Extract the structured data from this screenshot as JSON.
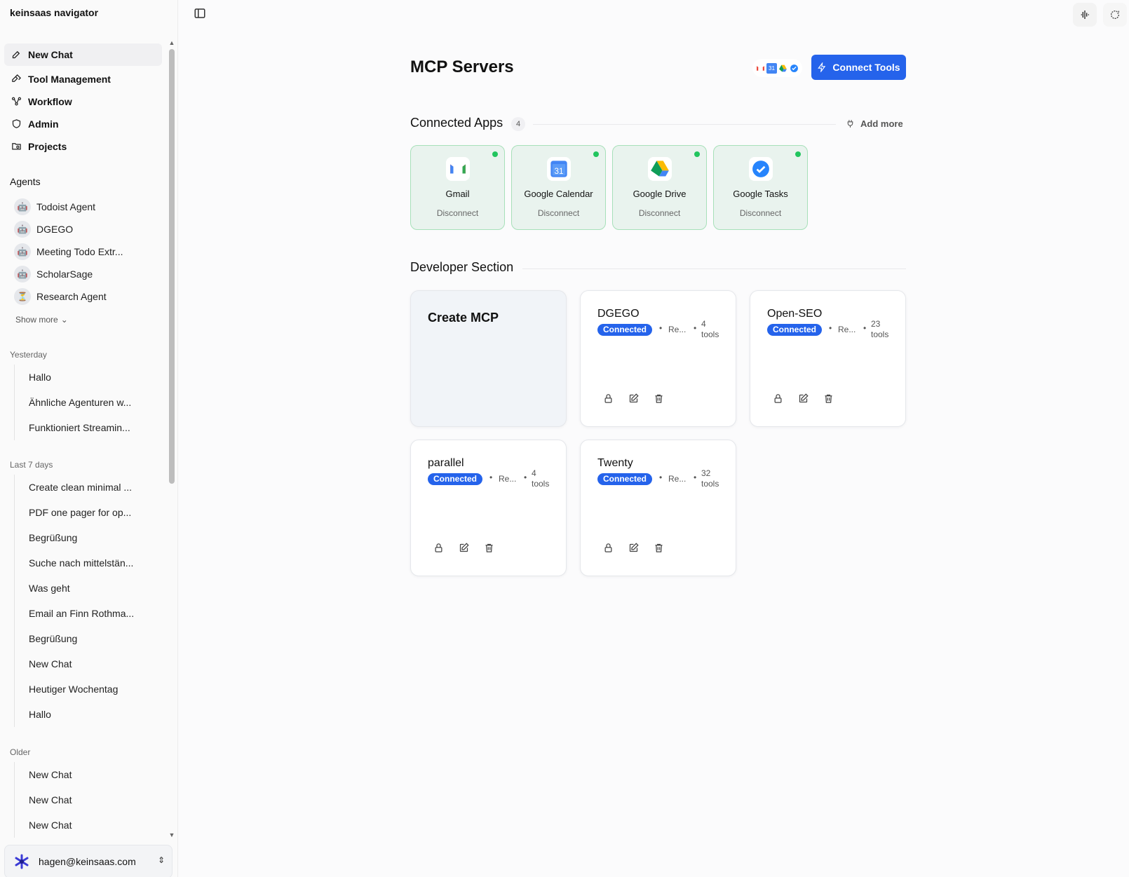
{
  "app": {
    "brand": "keinsaas navigator"
  },
  "nav": [
    {
      "label": "New Chat",
      "icon": "edit-icon"
    },
    {
      "label": "Tool Management",
      "icon": "tools-icon"
    },
    {
      "label": "Workflow",
      "icon": "workflow-icon"
    },
    {
      "label": "Admin",
      "icon": "shield-icon"
    },
    {
      "label": "Projects",
      "icon": "folder-icon"
    }
  ],
  "agents": {
    "label": "Agents",
    "items": [
      "Todoist Agent",
      "DGEGO",
      "Meeting Todo Extr...",
      "ScholarSage",
      "Research Agent"
    ],
    "show_more": "Show more"
  },
  "history": {
    "yesterday": {
      "label": "Yesterday",
      "items": [
        "Hallo",
        "Ähnliche Agenturen w...",
        "Funktioniert Streamin..."
      ]
    },
    "last7": {
      "label": "Last 7 days",
      "items": [
        "Create clean minimal ...",
        "PDF one pager for op...",
        "Begrüßung",
        "Suche nach mittelstän...",
        "Was geht",
        "Email an Finn Rothma...",
        "Begrüßung",
        "New Chat",
        "Heutiger Wochentag",
        "Hallo"
      ]
    },
    "older": {
      "label": "Older",
      "items": [
        "New Chat",
        "New Chat",
        "New Chat"
      ]
    }
  },
  "user": {
    "email": "hagen@keinsaas.com"
  },
  "page": {
    "title": "MCP Servers",
    "connect_label": "Connect Tools"
  },
  "connected_apps": {
    "title": "Connected Apps",
    "count": "4",
    "add_more": "Add more",
    "items": [
      {
        "name": "Gmail",
        "action": "Disconnect"
      },
      {
        "name": "Google Calendar",
        "action": "Disconnect"
      },
      {
        "name": "Google Drive",
        "action": "Disconnect"
      },
      {
        "name": "Google Tasks",
        "action": "Disconnect"
      }
    ]
  },
  "developer": {
    "title": "Developer Section",
    "create_label": "Create MCP",
    "servers": [
      {
        "name": "DGEGO",
        "status": "Connected",
        "transport": "Re...",
        "tools_num": "4",
        "tools_word": "tools"
      },
      {
        "name": "Open-SEO",
        "status": "Connected",
        "transport": "Re...",
        "tools_num": "23",
        "tools_word": "tools"
      },
      {
        "name": "parallel",
        "status": "Connected",
        "transport": "Re...",
        "tools_num": "4",
        "tools_word": "tools"
      },
      {
        "name": "Twenty",
        "status": "Connected",
        "transport": "Re...",
        "tools_num": "32",
        "tools_word": "tools"
      }
    ]
  },
  "colors": {
    "accent": "#2563eb",
    "connected_dot": "#22c55e",
    "app_card_bg": "#e9f3ee"
  }
}
